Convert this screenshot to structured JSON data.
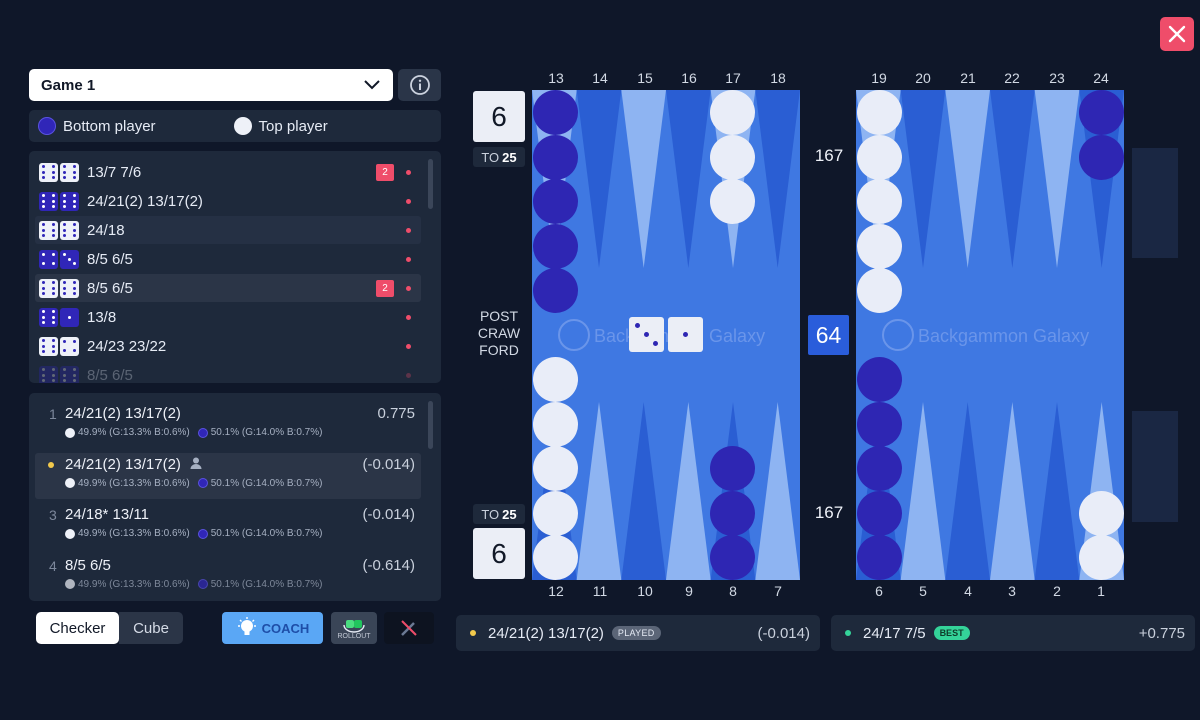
{
  "window": {
    "close_label": "×"
  },
  "game_select": {
    "value": "Game 1"
  },
  "players": {
    "bottom": "Bottom player",
    "top": "Top player",
    "bottom_color": "#3026b8",
    "top_color": "#eef1f8"
  },
  "move_list": [
    {
      "dice": [
        6,
        6
      ],
      "color": "white",
      "text": "13/7 7/6",
      "badge": "2"
    },
    {
      "dice": [
        6,
        6
      ],
      "color": "blue",
      "text": "24/21(2) 13/17(2)",
      "badge": ""
    },
    {
      "dice": [
        6,
        6
      ],
      "color": "white",
      "text": "24/18",
      "badge": ""
    },
    {
      "dice": [
        4,
        3
      ],
      "color": "blue",
      "text": "8/5 6/5",
      "badge": ""
    },
    {
      "dice": [
        6,
        6
      ],
      "color": "white",
      "text": "8/5 6/5",
      "badge": "2"
    },
    {
      "dice": [
        6,
        1
      ],
      "color": "blue",
      "text": "13/8",
      "badge": ""
    },
    {
      "dice": [
        6,
        4
      ],
      "color": "white",
      "text": "24/23 23/22",
      "badge": ""
    },
    {
      "dice": [
        6,
        6
      ],
      "color": "blue",
      "text": "8/5 6/5",
      "badge": ""
    }
  ],
  "analysis": [
    {
      "rank": "1",
      "move": "24/21(2) 13/17(2)",
      "value": "0.775",
      "w": "49.9% (G:13.3% B:0.6%)",
      "b": "50.1% (G:14.0% B:0.7%)"
    },
    {
      "rank": "",
      "move": "24/21(2) 13/17(2)",
      "value": "(-0.014)",
      "w": "49.9% (G:13.3% B:0.6%)",
      "b": "50.1% (G:14.0% B:0.7%)"
    },
    {
      "rank": "3",
      "move": "24/18* 13/11",
      "value": "(-0.014)",
      "w": "49.9% (G:13.3% B:0.6%)",
      "b": "50.1% (G:14.0% B:0.7%)"
    },
    {
      "rank": "4",
      "move": "8/5 6/5",
      "value": "(-0.614)",
      "w": "49.9% (G:13.3% B:0.6%)",
      "b": "50.1% (G:14.0% B:0.7%)"
    }
  ],
  "controls": {
    "checker": "Checker",
    "cube": "Cube",
    "coach": "COACH",
    "rollout": "ROLLOUT"
  },
  "board": {
    "top_points": [
      "13",
      "14",
      "15",
      "16",
      "17",
      "18",
      "19",
      "20",
      "21",
      "22",
      "23",
      "24"
    ],
    "bottom_points": [
      "12",
      "11",
      "10",
      "9",
      "8",
      "7",
      "6",
      "5",
      "4",
      "3",
      "2",
      "1"
    ],
    "cube_top": "6",
    "cube_bottom": "6",
    "to_label": "TO",
    "to_value": "25",
    "center_label": "POST CRAW FORD",
    "pip_top": "167",
    "pip_bottom": "167",
    "doubling_cube": "64",
    "watermark": "Backgammon Galaxy",
    "dice": [
      3,
      1
    ],
    "colors": {
      "board": "#3f78e2",
      "light_triangle": "#8eb4f2",
      "dark_triangle": "#2a5ed3",
      "blue_checker": "#2e26b3",
      "white_checker": "#e9edf8"
    }
  },
  "played_bar": {
    "move": "24/21(2) 13/17(2)",
    "tag": "PLAYED",
    "value": "(-0.014)"
  },
  "best_bar": {
    "move": "24/17 7/5",
    "tag": "BEST",
    "value": "+0.775"
  }
}
